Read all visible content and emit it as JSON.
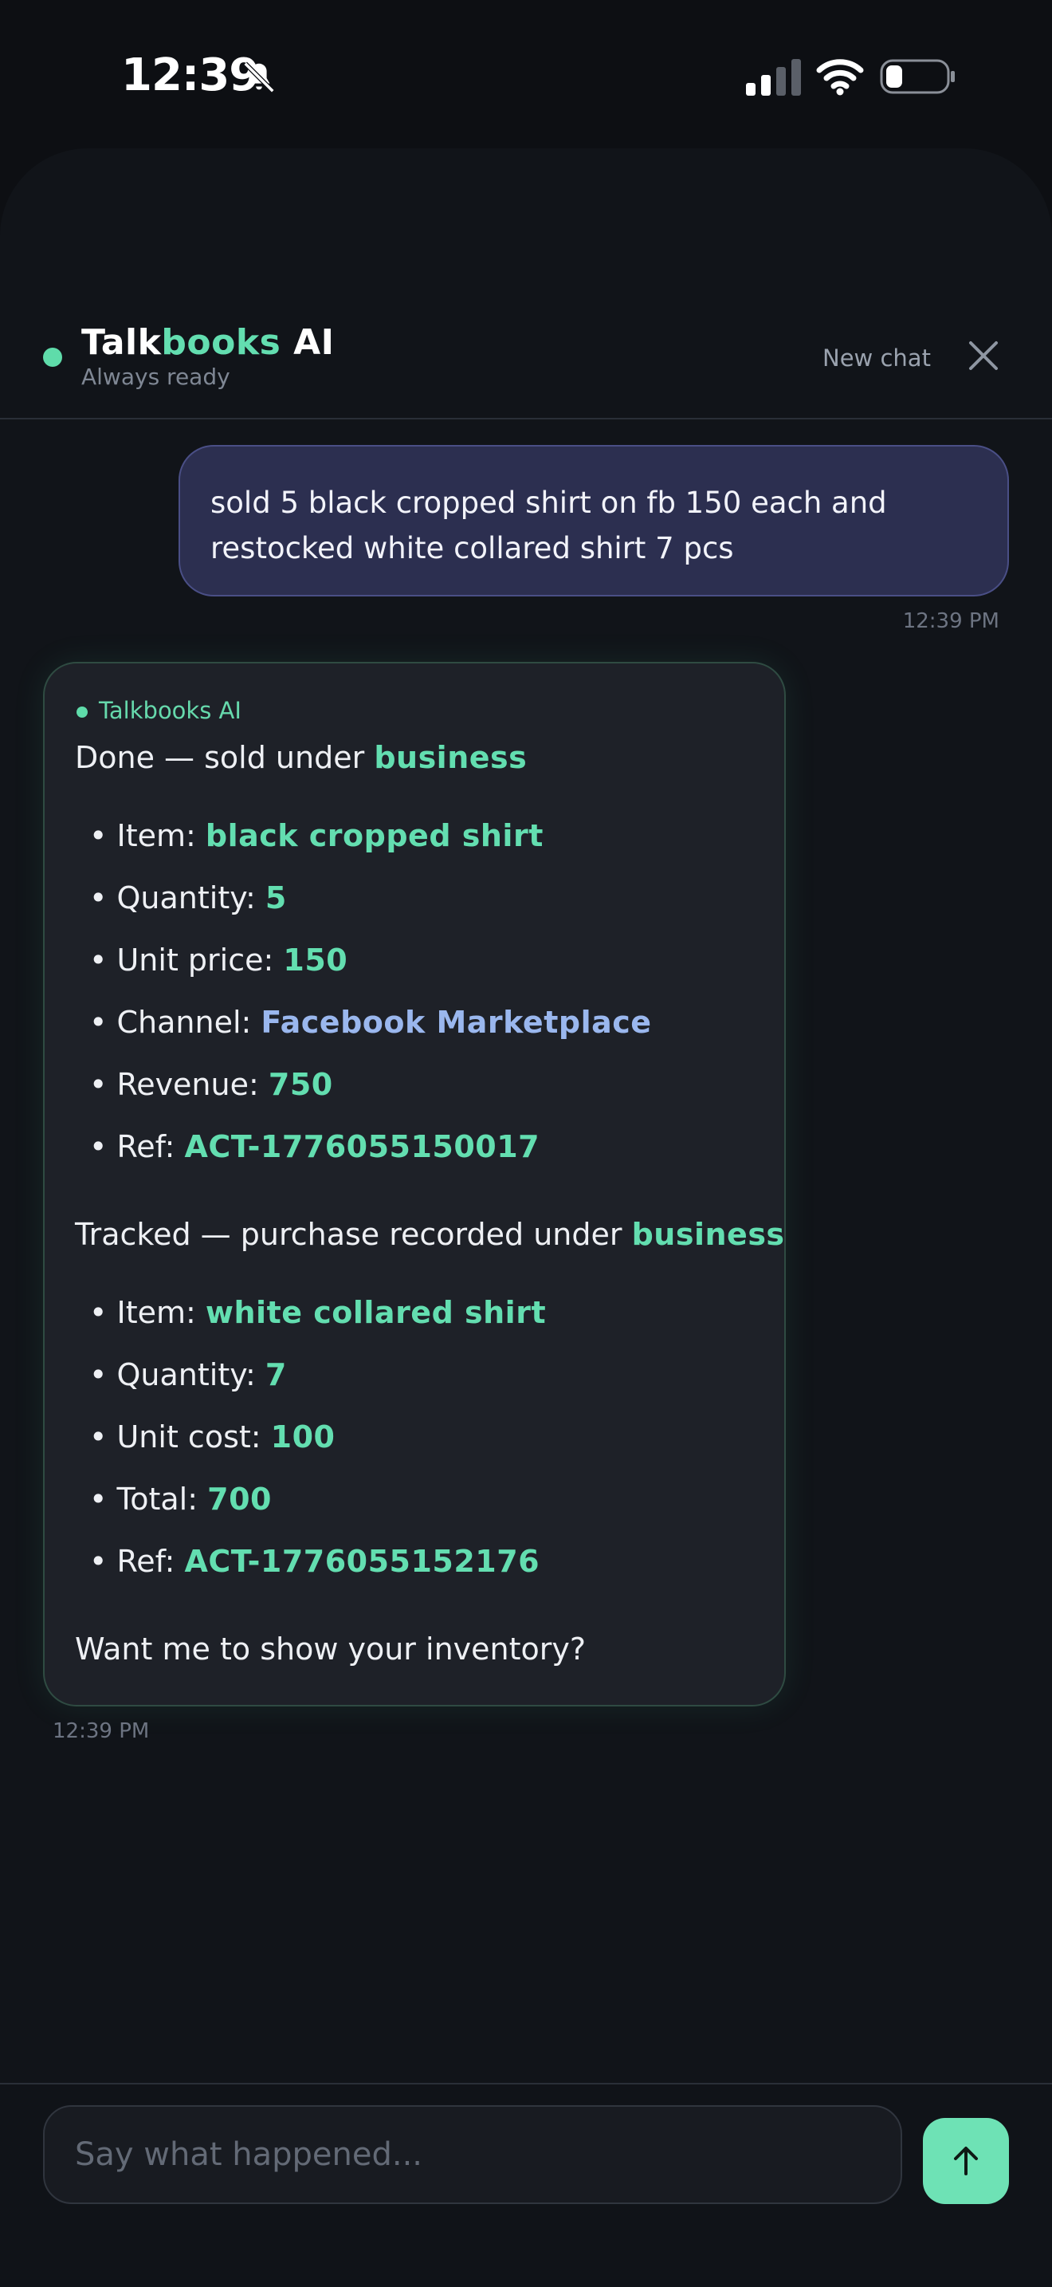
{
  "status_bar": {
    "time": "12:39"
  },
  "header": {
    "brand_part1": "Talk",
    "brand_part2": "books",
    "brand_part3": " AI",
    "subtitle": "Always ready",
    "new_chat_label": "New chat"
  },
  "messages": {
    "user": {
      "text": "sold 5 black cropped shirt on fb 150 each and restocked white collared shirt 7 pcs",
      "time": "12:39 PM"
    },
    "ai": {
      "sender": "Talkbooks AI",
      "time": "12:39 PM",
      "sale": {
        "intro": "Done — sold under ",
        "category": "business",
        "item_label": "• Item: ",
        "item": "black cropped shirt",
        "quantity_label": "• Quantity: ",
        "quantity": "5",
        "unit_price_label": "• Unit price: ",
        "unit_price": "150",
        "channel_label": "• Channel: ",
        "channel": "Facebook Marketplace",
        "revenue_label": "• Revenue: ",
        "revenue": "750",
        "ref_label": "• Ref: ",
        "ref": "ACT-1776055150017"
      },
      "purchase": {
        "intro": "Tracked — purchase recorded under ",
        "category": "business",
        "item_label": "• Item: ",
        "item": "white collared shirt",
        "quantity_label": "• Quantity: ",
        "quantity": "7",
        "unit_cost_label": "• Unit cost: ",
        "unit_cost": "100",
        "total_label": "• Total: ",
        "total": "700",
        "ref_label": "• Ref: ",
        "ref": "ACT-1776055152176"
      },
      "followup": "Want me to show your inventory?"
    }
  },
  "composer": {
    "placeholder": "Say what happened..."
  },
  "colors": {
    "accent_green": "#63deb0",
    "accent_blue": "#9ab7ee",
    "user_bubble": "#2c2f50",
    "ai_bubble": "#1e2128",
    "send_button": "#6ee2b5"
  },
  "icons": {
    "silent": "bell-slash-icon",
    "signal": "cellular-signal-icon",
    "wifi": "wifi-icon",
    "battery": "battery-icon",
    "close": "close-icon",
    "send": "arrow-up-icon"
  }
}
